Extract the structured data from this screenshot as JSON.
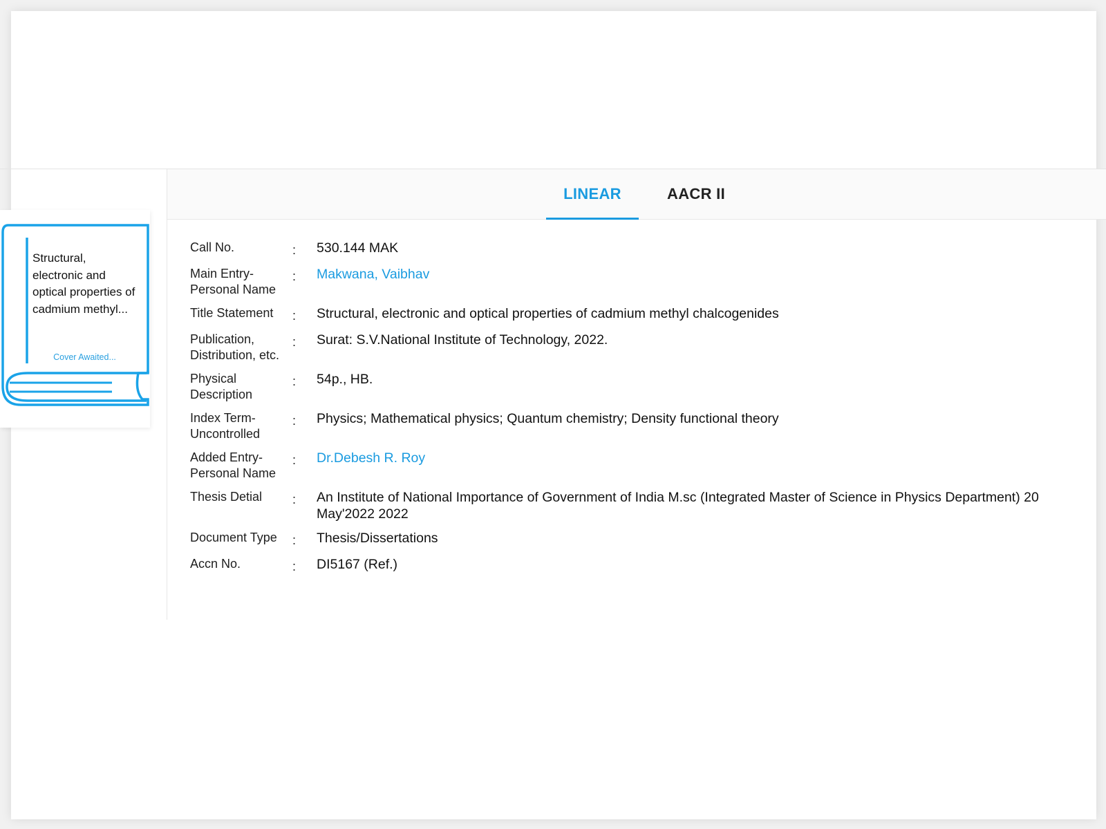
{
  "cover": {
    "title": "Structural, electronic and optical properties of cadmium methyl...",
    "status": "Cover Awaited..."
  },
  "tabs": [
    {
      "label": "LINEAR",
      "active": true
    },
    {
      "label": "AACR II",
      "active": false
    }
  ],
  "details": [
    {
      "label": "Call No.",
      "value": "530.144 MAK"
    },
    {
      "label": "Main Entry- Personal Name",
      "value": "Makwana, Vaibhav",
      "link": true
    },
    {
      "label": "Title Statement",
      "value": "Structural, electronic and optical properties of cadmium methyl chalcogenides"
    },
    {
      "label": "Publication, Distribution, etc.",
      "value": "Surat: S.V.National Institute of Technology, 2022."
    },
    {
      "label": "Physical Description",
      "value": "54p., HB."
    },
    {
      "label": "Index Term- Uncontrolled",
      "value": "Physics; Mathematical physics; Quantum chemistry; Density functional theory"
    },
    {
      "label": "Added Entry- Personal Name",
      "value": "Dr.Debesh R. Roy",
      "link": true
    },
    {
      "label": "Thesis Detial",
      "value": "An Institute of National Importance of Government of India M.sc (Integrated Master of Science in Physics Department) 20 May'2022 2022"
    },
    {
      "label": "Document Type",
      "value": "Thesis/Dissertations"
    },
    {
      "label": "Accn No.",
      "value": "DI5167 (Ref.)"
    }
  ],
  "separator": ":",
  "colors": {
    "accent": "#1a9be0",
    "text": "#111111"
  }
}
